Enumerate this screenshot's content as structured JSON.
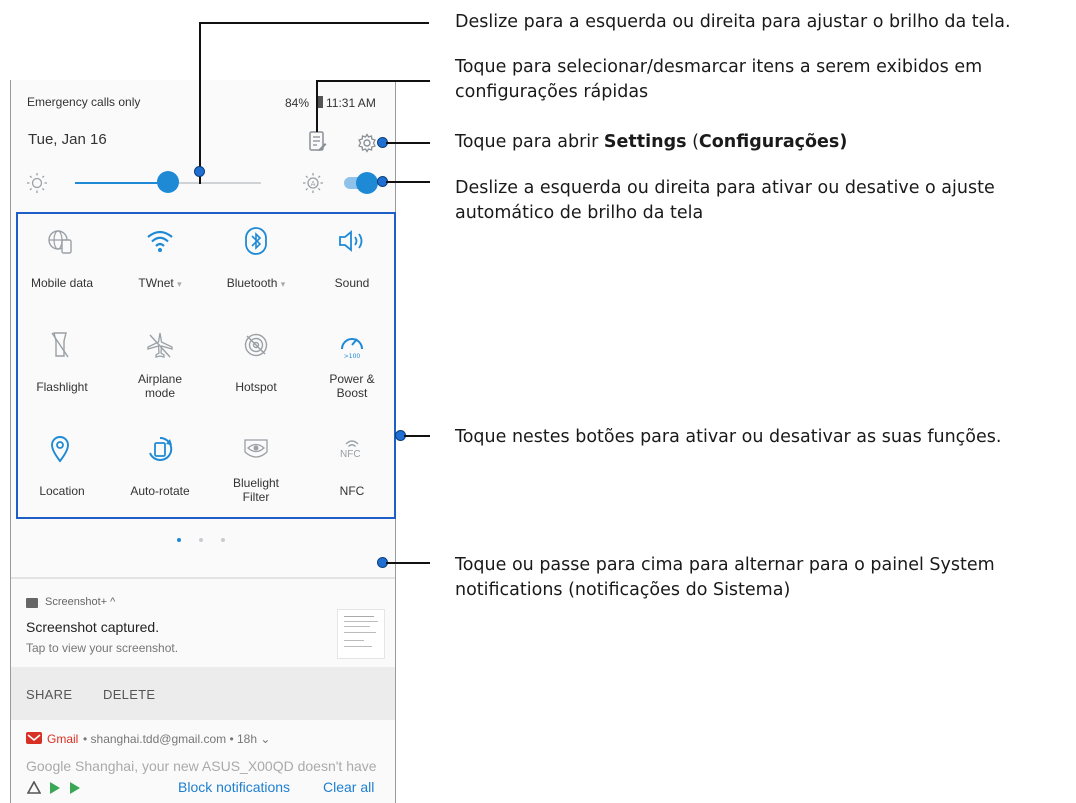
{
  "status_bar": {
    "carrier": "Emergency calls only",
    "battery": "84%",
    "time": "11:31 AM"
  },
  "header": {
    "date": "Tue, Jan 16"
  },
  "brightness": {
    "level": 0.5,
    "auto_brightness_on": true
  },
  "colors": {
    "accent": "#1e8ad6",
    "frame_blue": "#1e5ec7",
    "link_blue": "#1e7fd0",
    "gmail_red": "#d93025"
  },
  "tiles": [
    {
      "label": "Mobile data",
      "icon": "globe-phone-icon",
      "active": false
    },
    {
      "label": "TWnet ▾",
      "icon": "wifi-icon",
      "active": true
    },
    {
      "label": "Bluetooth ▾",
      "icon": "bluetooth-icon",
      "active": true
    },
    {
      "label": "Sound",
      "icon": "sound-icon",
      "active": true
    },
    {
      "label": "Flashlight",
      "icon": "flashlight-icon",
      "active": false
    },
    {
      "label": "Airplane\nmode",
      "icon": "airplane-icon",
      "active": false
    },
    {
      "label": "Hotspot",
      "icon": "hotspot-icon",
      "active": false
    },
    {
      "label": "Power &\nBoost",
      "icon": "boost-gauge-icon",
      "active": true,
      "sub": ">100"
    },
    {
      "label": "Location",
      "icon": "location-icon",
      "active": true
    },
    {
      "label": "Auto-rotate",
      "icon": "auto-rotate-icon",
      "active": true
    },
    {
      "label": "Bluelight\nFilter",
      "icon": "eye-filter-icon",
      "active": false
    },
    {
      "label": "NFC",
      "icon": "nfc-icon",
      "active": false,
      "text": "NFC"
    }
  ],
  "pager": {
    "pages": 3,
    "current": 0
  },
  "notification_1": {
    "app": "Screenshot+ ^",
    "title": "Screenshot captured.",
    "body": "Tap to view your screenshot.",
    "actions": [
      "SHARE",
      "DELETE"
    ]
  },
  "notification_2": {
    "app": "Gmail",
    "meta": " • shanghai.tdd@gmail.com • 18h ⌄",
    "preview": "Google  Shanghai, your new ASUS_X00QD doesn't have"
  },
  "footer": {
    "block": "Block notifications",
    "clear": "Clear all"
  },
  "annotations": {
    "brightness": "Deslize para a esquerda ou direita para ajustar o brilho da tela.",
    "edit_line1": "Toque para selecionar/desmarcar itens a serem exibidos em",
    "edit_line2": "configurações rápidas",
    "settings_pre": "Toque para abrir ",
    "settings_bold1": "Settings",
    "settings_mid": " (",
    "settings_bold2": "Configurações)",
    "auto_line1": "Deslize a esquerda ou direita para ativar ou desative o ajuste",
    "auto_line2": "automático de brilho da tela",
    "tiles": "Toque nestes botões para ativar ou desativar as suas funções.",
    "system_line1": "Toque ou passe para cima para alternar para o painel System",
    "system_line2": "notifications (notificações do Sistema)"
  }
}
